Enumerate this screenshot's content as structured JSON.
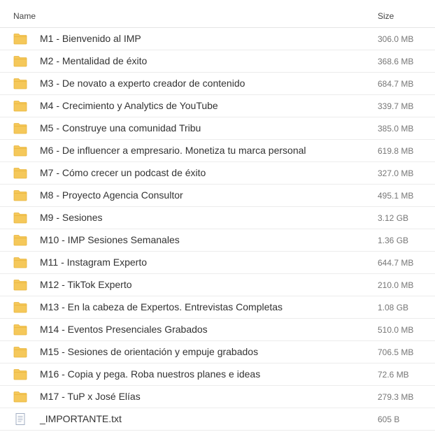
{
  "header": {
    "name_label": "Name",
    "size_label": "Size"
  },
  "items": [
    {
      "type": "folder",
      "icon": "folder-icon",
      "name": "M1 - Bienvenido al IMP",
      "size": "306.0 MB"
    },
    {
      "type": "folder",
      "icon": "folder-icon",
      "name": "M2 - Mentalidad de éxito",
      "size": "368.6 MB"
    },
    {
      "type": "folder",
      "icon": "folder-icon",
      "name": "M3 - De novato a experto creador de contenido",
      "size": "684.7 MB"
    },
    {
      "type": "folder",
      "icon": "folder-icon",
      "name": "M4 - Crecimiento y Analytics de YouTube",
      "size": "339.7 MB"
    },
    {
      "type": "folder",
      "icon": "folder-icon",
      "name": "M5 - Construye una comunidad Tribu",
      "size": "385.0 MB"
    },
    {
      "type": "folder",
      "icon": "folder-icon",
      "name": "M6 - De influencer a empresario. Monetiza tu marca personal",
      "size": "619.8 MB"
    },
    {
      "type": "folder",
      "icon": "folder-icon",
      "name": "M7 - Cómo crecer un podcast de éxito",
      "size": "327.0 MB"
    },
    {
      "type": "folder",
      "icon": "folder-icon",
      "name": "M8 - Proyecto Agencia Consultor",
      "size": "495.1 MB"
    },
    {
      "type": "folder",
      "icon": "folder-icon",
      "name": "M9 - Sesiones",
      "size": "3.12 GB"
    },
    {
      "type": "folder",
      "icon": "folder-icon",
      "name": "M10 - IMP Sesiones Semanales",
      "size": "1.36 GB"
    },
    {
      "type": "folder",
      "icon": "folder-icon",
      "name": "M11 - Instagram Experto",
      "size": "644.7 MB"
    },
    {
      "type": "folder",
      "icon": "folder-icon",
      "name": "M12 - TikTok Experto",
      "size": "210.0 MB"
    },
    {
      "type": "folder",
      "icon": "folder-icon",
      "name": "M13 - En la cabeza de Expertos. Entrevistas Completas",
      "size": "1.08 GB"
    },
    {
      "type": "folder",
      "icon": "folder-icon",
      "name": "M14 - Eventos Presenciales Grabados",
      "size": "510.0 MB"
    },
    {
      "type": "folder",
      "icon": "folder-icon",
      "name": "M15 - Sesiones de orientación y empuje grabados",
      "size": "706.5 MB"
    },
    {
      "type": "folder",
      "icon": "folder-icon",
      "name": "M16 - Copia y pega. Roba nuestros planes e ideas",
      "size": "72.6 MB"
    },
    {
      "type": "folder",
      "icon": "folder-icon",
      "name": "M17 - TuP x José Elías",
      "size": "279.3 MB"
    },
    {
      "type": "file",
      "icon": "text-file-icon",
      "name": "_IMPORTANTE.txt",
      "size": "605 B"
    }
  ],
  "colors": {
    "folder_fill": "#f5c85a",
    "folder_tab": "#e8b53d",
    "file_stroke": "#9aa7bd"
  }
}
